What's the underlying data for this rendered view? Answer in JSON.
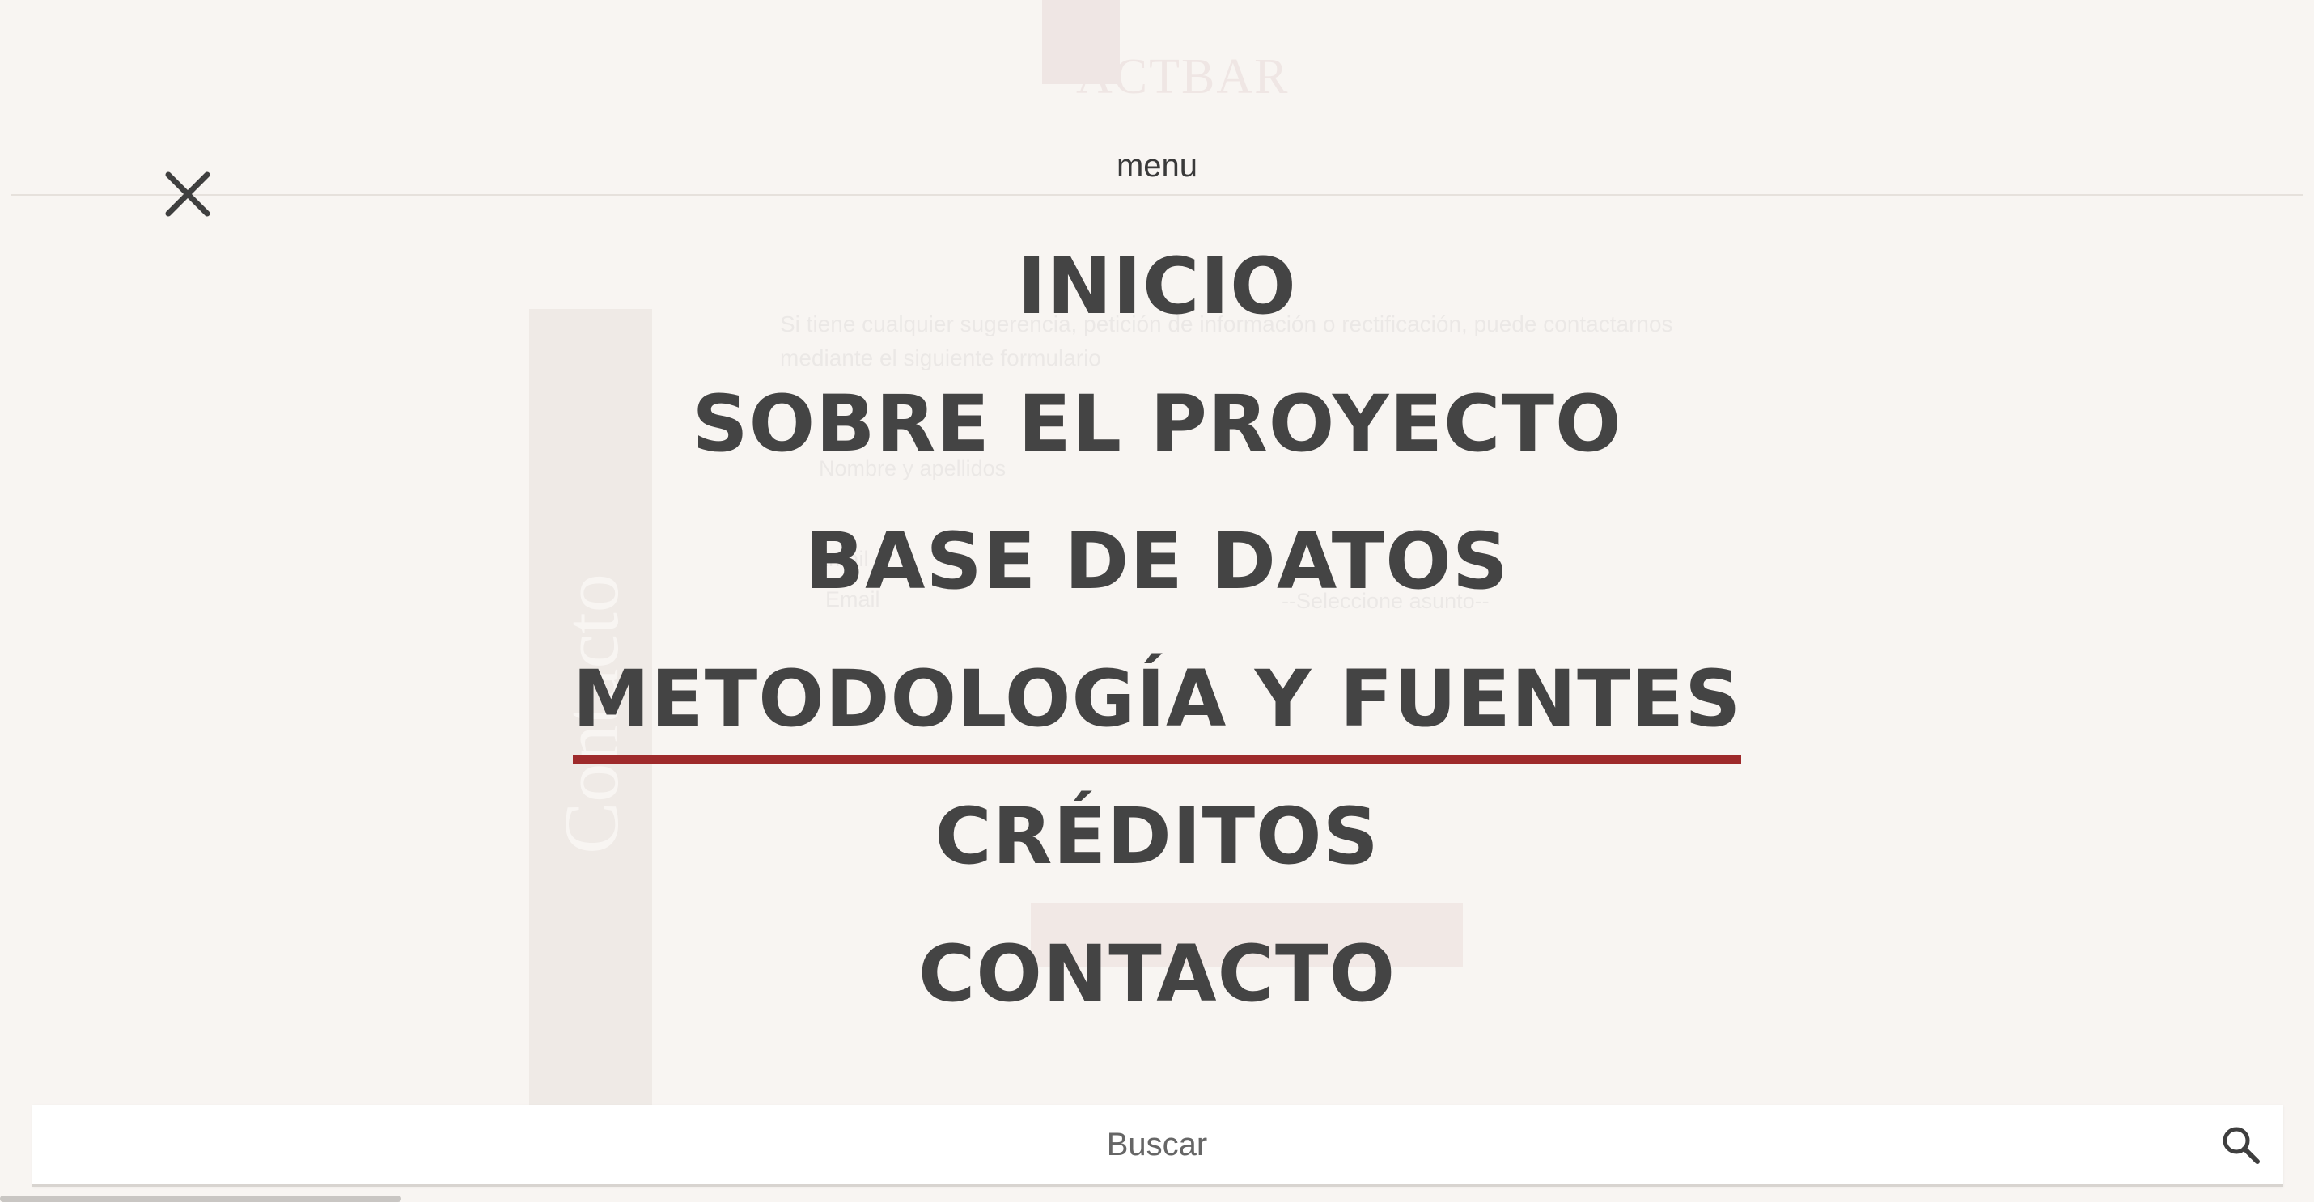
{
  "background": {
    "logo_text": "ACTBAR",
    "side_tab_label": "Contacto",
    "intro_text": "Si tiene cualquier sugerencia, petición de información o rectificación, puede contactarnos mediante el siguiente formulario",
    "name_placeholder": "Nombre y apellidos",
    "email_label": "Email",
    "email_placeholder": "Email",
    "subject_placeholder": "--Seleccione asunto--"
  },
  "menu": {
    "title": "menu",
    "close_icon": "close-icon",
    "items": [
      {
        "label": "INICIO",
        "active": false
      },
      {
        "label": "SOBRE EL PROYECTO",
        "active": false
      },
      {
        "label": "BASE DE DATOS",
        "active": false
      },
      {
        "label": "METODOLOGÍA Y FUENTES",
        "active": true
      },
      {
        "label": "CRÉDITOS",
        "active": false
      },
      {
        "label": "CONTACTO",
        "active": false
      }
    ]
  },
  "search": {
    "placeholder": "Buscar",
    "icon": "search-icon"
  },
  "colors": {
    "background": "#f8f5f2",
    "menu_text": "#444444",
    "active_underline": "#9e2a2b"
  }
}
